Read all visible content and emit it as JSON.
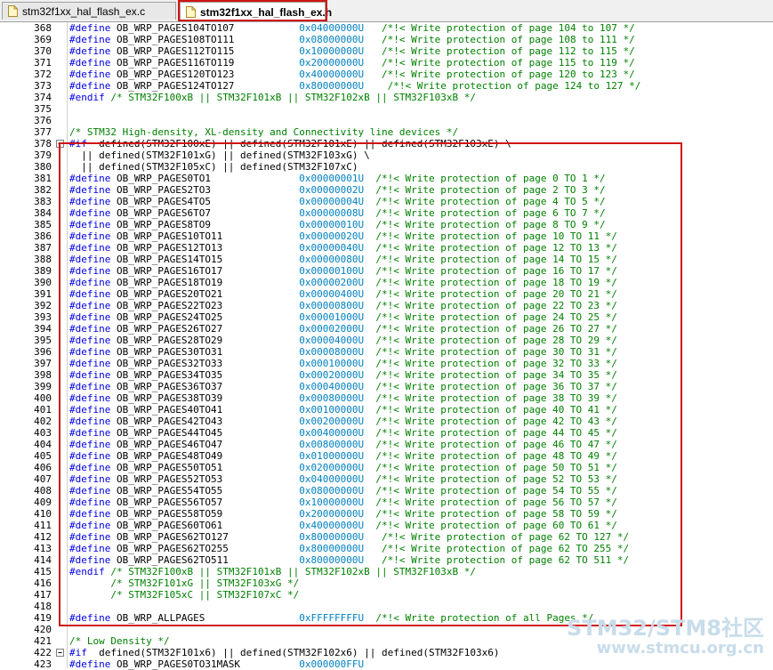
{
  "tabs": [
    {
      "label": "stm32f1xx_hal_flash_ex.c",
      "active": false
    },
    {
      "label": "stm32f1xx_hal_flash_ex.h",
      "active": true
    }
  ],
  "lines": [
    {
      "n": "368",
      "t": "#define OB_WRP_PAGES104TO107           0x04000000U   /*!< Write protection of page 104 to 107 */"
    },
    {
      "n": "369",
      "t": "#define OB_WRP_PAGES108TO111           0x08000000U   /*!< Write protection of page 108 to 111 */"
    },
    {
      "n": "370",
      "t": "#define OB_WRP_PAGES112TO115           0x10000000U   /*!< Write protection of page 112 to 115 */"
    },
    {
      "n": "371",
      "t": "#define OB_WRP_PAGES116TO119           0x20000000U   /*!< Write protection of page 115 to 119 */"
    },
    {
      "n": "372",
      "t": "#define OB_WRP_PAGES120TO123           0x40000000U   /*!< Write protection of page 120 to 123 */"
    },
    {
      "n": "373",
      "t": "#define OB_WRP_PAGES124TO127           0x80000000U    /*!< Write protection of page 124 to 127 */"
    },
    {
      "n": "374",
      "t": "#endif /* STM32F100xB || STM32F101xB || STM32F102xB || STM32F103xB */"
    },
    {
      "n": "375",
      "t": ""
    },
    {
      "n": "376",
      "t": ""
    },
    {
      "n": "377",
      "t": "/* STM32 High-density, XL-density and Connectivity line devices */"
    },
    {
      "n": "378",
      "t": "#if  defined(STM32F100xE) || defined(STM32F101xE) || defined(STM32F103xE) \\",
      "fold": "minus"
    },
    {
      "n": "379",
      "t": "  || defined(STM32F101xG) || defined(STM32F103xG) \\"
    },
    {
      "n": "380",
      "t": "  || defined(STM32F105xC) || defined(STM32F107xC)"
    },
    {
      "n": "381",
      "t": "#define OB_WRP_PAGES0TO1               0x00000001U  /*!< Write protection of page 0 TO 1 */"
    },
    {
      "n": "382",
      "t": "#define OB_WRP_PAGES2TO3               0x00000002U  /*!< Write protection of page 2 TO 3 */"
    },
    {
      "n": "383",
      "t": "#define OB_WRP_PAGES4TO5               0x00000004U  /*!< Write protection of page 4 TO 5 */"
    },
    {
      "n": "384",
      "t": "#define OB_WRP_PAGES6TO7               0x00000008U  /*!< Write protection of page 6 TO 7 */"
    },
    {
      "n": "385",
      "t": "#define OB_WRP_PAGES8TO9               0x00000010U  /*!< Write protection of page 8 TO 9 */"
    },
    {
      "n": "386",
      "t": "#define OB_WRP_PAGES10TO11             0x00000020U  /*!< Write protection of page 10 TO 11 */"
    },
    {
      "n": "387",
      "t": "#define OB_WRP_PAGES12TO13             0x00000040U  /*!< Write protection of page 12 TO 13 */"
    },
    {
      "n": "388",
      "t": "#define OB_WRP_PAGES14TO15             0x00000080U  /*!< Write protection of page 14 TO 15 */"
    },
    {
      "n": "389",
      "t": "#define OB_WRP_PAGES16TO17             0x00000100U  /*!< Write protection of page 16 TO 17 */"
    },
    {
      "n": "390",
      "t": "#define OB_WRP_PAGES18TO19             0x00000200U  /*!< Write protection of page 18 TO 19 */"
    },
    {
      "n": "391",
      "t": "#define OB_WRP_PAGES20TO21             0x00000400U  /*!< Write protection of page 20 TO 21 */"
    },
    {
      "n": "392",
      "t": "#define OB_WRP_PAGES22TO23             0x00000800U  /*!< Write protection of page 22 TO 23 */"
    },
    {
      "n": "393",
      "t": "#define OB_WRP_PAGES24TO25             0x00001000U  /*!< Write protection of page 24 TO 25 */"
    },
    {
      "n": "394",
      "t": "#define OB_WRP_PAGES26TO27             0x00002000U  /*!< Write protection of page 26 TO 27 */"
    },
    {
      "n": "395",
      "t": "#define OB_WRP_PAGES28TO29             0x00004000U  /*!< Write protection of page 28 TO 29 */"
    },
    {
      "n": "396",
      "t": "#define OB_WRP_PAGES30TO31             0x00008000U  /*!< Write protection of page 30 TO 31 */"
    },
    {
      "n": "397",
      "t": "#define OB_WRP_PAGES32TO33             0x00010000U  /*!< Write protection of page 32 TO 33 */"
    },
    {
      "n": "398",
      "t": "#define OB_WRP_PAGES34TO35             0x00020000U  /*!< Write protection of page 34 TO 35 */"
    },
    {
      "n": "399",
      "t": "#define OB_WRP_PAGES36TO37             0x00040000U  /*!< Write protection of page 36 TO 37 */"
    },
    {
      "n": "400",
      "t": "#define OB_WRP_PAGES38TO39             0x00080000U  /*!< Write protection of page 38 TO 39 */"
    },
    {
      "n": "401",
      "t": "#define OB_WRP_PAGES40TO41             0x00100000U  /*!< Write protection of page 40 TO 41 */"
    },
    {
      "n": "402",
      "t": "#define OB_WRP_PAGES42TO43             0x00200000U  /*!< Write protection of page 42 TO 43 */"
    },
    {
      "n": "403",
      "t": "#define OB_WRP_PAGES44TO45             0x00400000U  /*!< Write protection of page 44 TO 45 */"
    },
    {
      "n": "404",
      "t": "#define OB_WRP_PAGES46TO47             0x00800000U  /*!< Write protection of page 46 TO 47 */"
    },
    {
      "n": "405",
      "t": "#define OB_WRP_PAGES48TO49             0x01000000U  /*!< Write protection of page 48 TO 49 */"
    },
    {
      "n": "406",
      "t": "#define OB_WRP_PAGES50TO51             0x02000000U  /*!< Write protection of page 50 TO 51 */"
    },
    {
      "n": "407",
      "t": "#define OB_WRP_PAGES52TO53             0x04000000U  /*!< Write protection of page 52 TO 53 */"
    },
    {
      "n": "408",
      "t": "#define OB_WRP_PAGES54TO55             0x08000000U  /*!< Write protection of page 54 TO 55 */"
    },
    {
      "n": "409",
      "t": "#define OB_WRP_PAGES56TO57             0x10000000U  /*!< Write protection of page 56 TO 57 */"
    },
    {
      "n": "410",
      "t": "#define OB_WRP_PAGES58TO59             0x20000000U  /*!< Write protection of page 58 TO 59 */"
    },
    {
      "n": "411",
      "t": "#define OB_WRP_PAGES60TO61             0x40000000U  /*!< Write protection of page 60 TO 61 */"
    },
    {
      "n": "412",
      "t": "#define OB_WRP_PAGES62TO127            0x80000000U   /*!< Write protection of page 62 TO 127 */"
    },
    {
      "n": "413",
      "t": "#define OB_WRP_PAGES62TO255            0x80000000U   /*!< Write protection of page 62 TO 255 */"
    },
    {
      "n": "414",
      "t": "#define OB_WRP_PAGES62TO511            0x80000000U   /*!< Write protection of page 62 TO 511 */"
    },
    {
      "n": "415",
      "t": "#endif /* STM32F100xB || STM32F101xB || STM32F102xB || STM32F103xB */"
    },
    {
      "n": "416",
      "t": "       /* STM32F101xG || STM32F103xG */"
    },
    {
      "n": "417",
      "t": "       /* STM32F105xC || STM32F107xC */"
    },
    {
      "n": "418",
      "t": ""
    },
    {
      "n": "419",
      "t": "#define OB_WRP_ALLPAGES                0xFFFFFFFFU  /*!< Write protection of all Pages */"
    },
    {
      "n": "420",
      "t": ""
    },
    {
      "n": "421",
      "t": "/* Low Density */"
    },
    {
      "n": "422",
      "t": "#if  defined(STM32F101x6) || defined(STM32F102x6) || defined(STM32F103x6)",
      "fold": "minus"
    },
    {
      "n": "423",
      "t": "#define OB_WRP_PAGES0TO31MASK          0x000000FFU"
    }
  ],
  "watermark": {
    "line1": "STM32/STM8社区",
    "line2": "www.stmcu.org.cn"
  },
  "colors": {
    "keyword": "#0000e6",
    "hex": "#0080c0",
    "comment": "#008000",
    "highlight": "#d01414"
  }
}
